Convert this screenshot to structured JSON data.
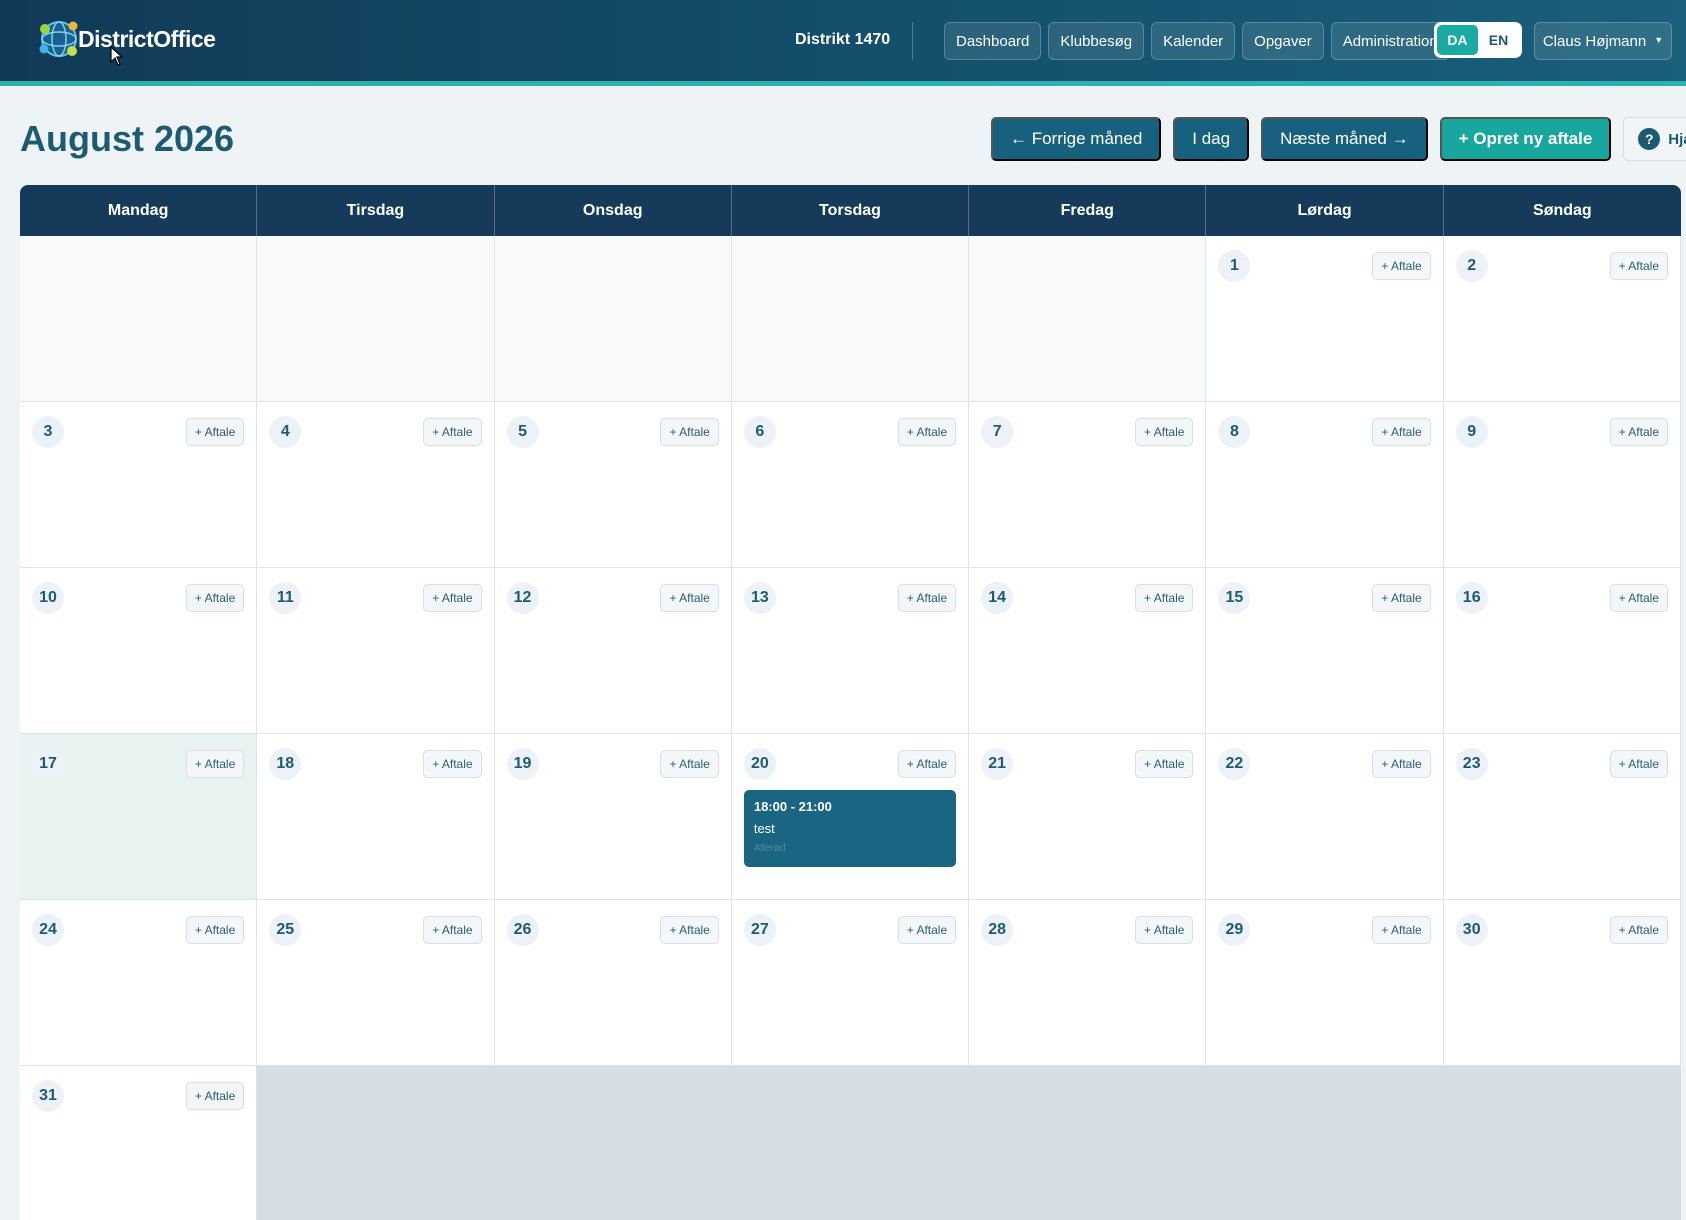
{
  "app": {
    "logo_text": "DistrictOffice",
    "district": "Distrikt 1470",
    "nav": [
      "Dashboard",
      "Klubbesøg",
      "Kalender",
      "Opgaver",
      "Administration"
    ],
    "languages": [
      "DA",
      "EN"
    ],
    "active_language": "DA",
    "user_name": "Claus Højmann"
  },
  "page": {
    "title": "August 2026",
    "prev_label": "← Forrige måned",
    "today_label": "I dag",
    "next_label": "Næste måned →",
    "create_label": "+ Opret ny aftale",
    "help_label": "Hjælp",
    "help_icon": "?"
  },
  "calendar": {
    "weekdays": [
      "Mandag",
      "Tirsdag",
      "Onsdag",
      "Torsdag",
      "Fredag",
      "Lørdag",
      "Søndag"
    ],
    "add_label": "+ Aftale",
    "leading_empty_days": 5,
    "days_in_month": 31,
    "today": 17,
    "events": [
      {
        "day": 20,
        "time": "18:00 - 21:00",
        "title": "test",
        "location": "Allerød"
      }
    ]
  },
  "colors": {
    "header_bg": "#14506c",
    "accent_teal": "#18a79e",
    "button_blue": "#18617e",
    "event_bg": "#1a6581",
    "weekday_bar": "#163a5a"
  }
}
